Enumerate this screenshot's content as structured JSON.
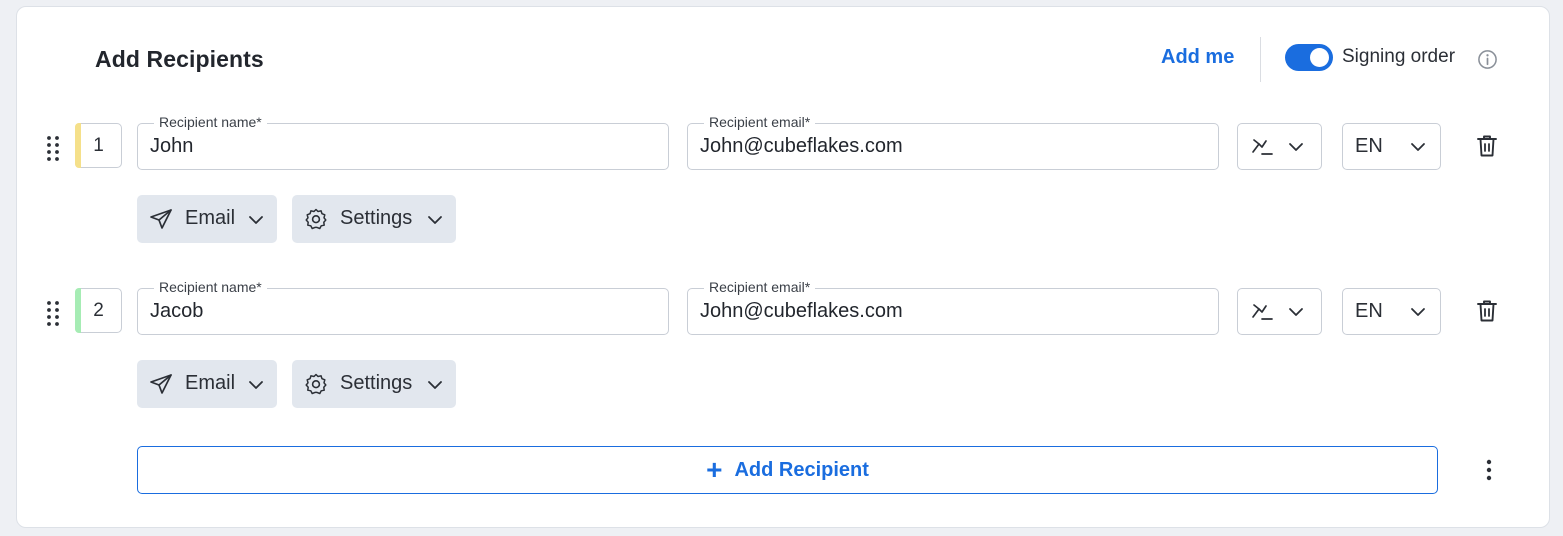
{
  "header": {
    "title": "Add Recipients",
    "add_me": "Add me",
    "signing_order_label": "Signing order",
    "signing_order_on": true
  },
  "recipients": [
    {
      "order": "1",
      "stripe_color": "#f5e08a",
      "name_label": "Recipient name*",
      "name_value": "John",
      "email_label": "Recipient email*",
      "email_value": "John@cubeflakes.com",
      "role_icon": "signature-icon",
      "language": "EN",
      "delivery": "Email",
      "settings": "Settings"
    },
    {
      "order": "2",
      "stripe_color": "#a6ecb4",
      "name_label": "Recipient name*",
      "name_value": "Jacob",
      "email_label": "Recipient email*",
      "email_value": "John@cubeflakes.com",
      "role_icon": "signature-icon",
      "language": "EN",
      "delivery": "Email",
      "settings": "Settings"
    }
  ],
  "footer": {
    "add_recipient": "Add Recipient"
  },
  "colors": {
    "accent": "#1a6ddf",
    "chip_bg": "#e2e7ee",
    "border": "#c9ced6"
  }
}
